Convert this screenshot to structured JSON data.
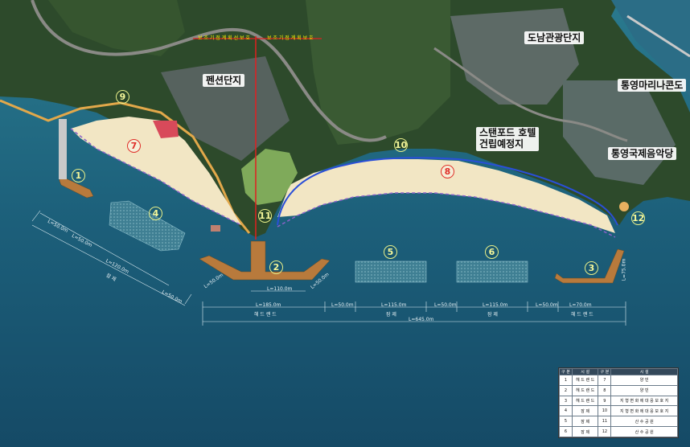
{
  "place_labels": {
    "pension": "펜션단지",
    "tourism": "도남관광단지",
    "marina": "통영마리나콘도",
    "music_hall": "통영국제음악당",
    "stanford_line1": "스탠포드 호텔",
    "stanford_line2": "건립예정지"
  },
  "numbers": [
    "1",
    "2",
    "3",
    "4",
    "5",
    "6",
    "7",
    "8",
    "9",
    "10",
    "11",
    "12"
  ],
  "top_dims": {
    "left": "보 조 기 점 계 획 선 보 호",
    "right": "보 조 기 점 계 획 보 호"
  },
  "dims": {
    "seg1": "L=185.0m",
    "seg2": "L=50.0m",
    "seg3": "L=115.0m",
    "seg4": "L=50.0m",
    "seg5": "L=115.0m",
    "seg6": "L=50.0m",
    "seg7": "L=70.0m",
    "total": "L=645.0m",
    "sub1": "헤 드 랜 드",
    "sub2": "잠 제",
    "sub3": "잠 제",
    "sub4": "헤 드 랜 드",
    "l110": "L=110.0m",
    "l50a": "L=50.0m",
    "l50b": "L=50.0m",
    "l75": "L=75.0m",
    "diag1": "L=50.0m",
    "diag2": "L=50.0m",
    "diag3": "L=120.0m",
    "diag4": "L=50.0m",
    "diag_sub": "잠 제"
  },
  "legend": {
    "headers": [
      "구 분",
      "시 설",
      "구 분",
      "시 설"
    ],
    "rows": [
      [
        "1",
        "헤 드 랜 드",
        "7",
        "양 빈"
      ],
      [
        "2",
        "헤 드 랜 드",
        "8",
        "양 빈"
      ],
      [
        "3",
        "헤 드 랜 드",
        "9",
        "지 형 변 화 에 대 응 보 호 지"
      ],
      [
        "4",
        "잠 제",
        "10",
        "지 형 변 화 에 대 응 보 호 지"
      ],
      [
        "5",
        "잠 제",
        "11",
        "산 수 공 원"
      ],
      [
        "6",
        "잠 제",
        "12",
        "산 수 공 원"
      ]
    ]
  },
  "colors": {
    "sea": "#1d5d7a",
    "sand": "#f2e6c4",
    "land": "#2f4a2c",
    "structure": "#b87a3c",
    "breakwater": "#4e8a9c",
    "boundary_dash": "#8a62c8",
    "red_line": "#e02020"
  }
}
